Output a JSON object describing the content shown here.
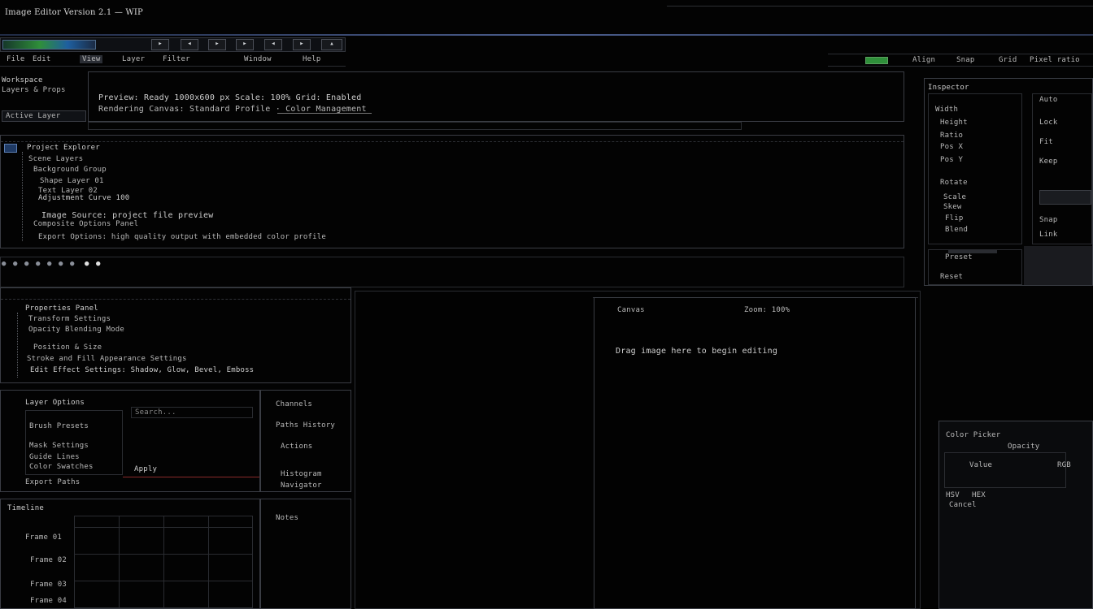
{
  "app": {
    "title": "Image Editor Version 2.1 — WIP"
  },
  "colors": {
    "accent": "#3e7fc1",
    "green": "#2f8f3a",
    "bg": "#030303",
    "panel": "#0c0d10"
  },
  "toolbar": {
    "main_buttons": [
      "▸",
      "◂",
      "▸",
      "▸",
      "◂",
      "▸",
      "▴"
    ],
    "sub_buttons": [
      "File",
      "Edit",
      "View",
      "Layer",
      "Filter",
      "Window",
      "Help"
    ],
    "right_labels": [
      "Align",
      "Snap",
      "Grid",
      "Pixel ratio"
    ]
  },
  "top_left": {
    "heading": "Workspace",
    "subheading": "Layers & Props",
    "label": "Active Layer"
  },
  "info_panel": {
    "row1": "Preview: Ready 1000x600 px  Scale: 100%   Grid: Enabled",
    "row2": "Rendering Canvas: Standard Profile · Color Management"
  },
  "tree": {
    "title": "Project Explorer",
    "items": [
      "Scene Layers",
      "Background Group",
      "Shape Layer 01",
      "Text Layer 02",
      "Adjustment Curve 100",
      "Image Source: project file preview",
      "Composite Options Panel",
      "Export Options: high quality output with embedded color profile"
    ]
  },
  "icon_row": [
    "●",
    "●",
    "●",
    "●",
    "●",
    "●",
    "●",
    "●",
    "●"
  ],
  "left_tree": {
    "title": "Properties Panel",
    "items": [
      "Transform Settings",
      "Opacity Blending Mode",
      "Position & Size",
      "Stroke and Fill Appearance Settings",
      "Edit Effect Settings: Shadow, Glow, Bevel, Emboss"
    ]
  },
  "sub_panel_a": {
    "title": "Layer Options",
    "items": [
      "Brush Presets",
      "Mask Settings",
      "Guide Lines",
      "Color Swatches",
      "Export Paths"
    ],
    "field_value": "Search...",
    "action": "Apply"
  },
  "sub_panel_b": {
    "items": [
      "Channels",
      "Paths History",
      "Actions",
      "Histogram",
      "Navigator"
    ]
  },
  "sub_panel_c": {
    "title": "Timeline",
    "items": [
      "Frame 01",
      "Frame 02",
      "Frame 03",
      "Frame 04"
    ]
  },
  "sub_panel_d": {
    "items": [
      "Notes"
    ]
  },
  "canvas": {
    "header_left": "Canvas",
    "header_right": "Zoom: 100%",
    "message": "Drag image here to begin editing"
  },
  "right_panel": {
    "header": "Inspector",
    "col1": [
      "Width",
      "Height",
      "Ratio",
      "Pos X",
      "Pos Y",
      "Rotate",
      "Scale",
      "Skew",
      "Flip",
      "Blend"
    ],
    "col2": [
      "Auto",
      "Lock",
      "Fit",
      "Keep",
      "Snap",
      "Link"
    ],
    "bottom": [
      "Preset",
      "Reset"
    ]
  },
  "dialog": {
    "title": "Color Picker",
    "label": "Opacity",
    "field": "Value",
    "options": [
      "RGB",
      "HSV",
      "HEX"
    ],
    "footer": "Cancel"
  }
}
